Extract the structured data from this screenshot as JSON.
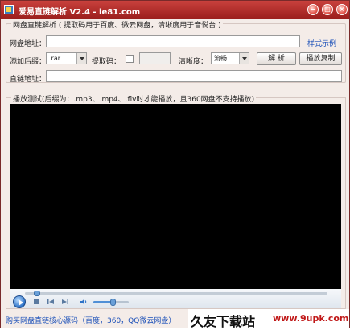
{
  "window": {
    "title": "爱易直链解析 V2.4 - ie81.com",
    "controls": {
      "minimize": "−",
      "restore": "□",
      "close": "×"
    }
  },
  "form": {
    "group_title": "网盘直链解析 ( 提取码用于百度、微云网盘，清晰度用于音悦台 )",
    "pan_url_label": "网盘地址：",
    "pan_url_value": "",
    "example_link": "样式示例",
    "suffix_label": "添加后缀：",
    "suffix_value": ".rar",
    "extract_code_label": "提取码：",
    "extract_code_value": "",
    "quality_label": "清晰度：",
    "quality_value": "流畅",
    "parse_button": "解 析",
    "copy_button": "播放复制",
    "direct_url_label": "直链地址：",
    "direct_url_value": ""
  },
  "player": {
    "group_title": "播放测试(后缀为：.mp3、.mp4、.flv时才能播放，且360网盘不支持播放)",
    "seek_progress": 0.03,
    "volume_level": 0.55
  },
  "footer": {
    "buy_link": "购买网盘直链核心源码（百度，360，QQ微云网盘）"
  },
  "watermark": {
    "text": "久友下载站",
    "url": "www.9upk.com"
  },
  "colors": {
    "titlebar": "#b3302d",
    "link": "#1a4fb8",
    "watermark_url": "#c01818"
  }
}
